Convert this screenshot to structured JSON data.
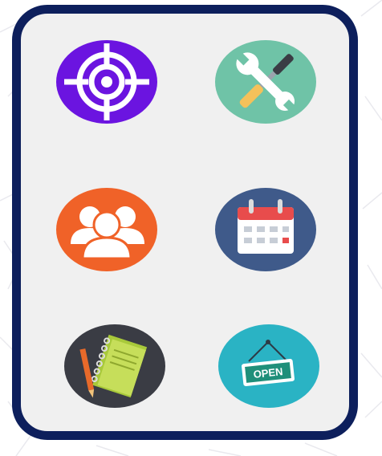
{
  "panel": {
    "border_color": "#0d1f5c",
    "background": "#f0f0f0"
  },
  "icons": [
    {
      "name": "target-icon",
      "bg": "#6b14e0"
    },
    {
      "name": "tools-icon",
      "bg": "#6fc3a7"
    },
    {
      "name": "group-icon",
      "bg": "#f06228"
    },
    {
      "name": "calendar-icon",
      "bg": "#3f5a8a"
    },
    {
      "name": "notebook-icon",
      "bg": "#3a3c44"
    },
    {
      "name": "open-sign-icon",
      "bg": "#2ab3c4",
      "sign_text": "OPEN"
    }
  ]
}
